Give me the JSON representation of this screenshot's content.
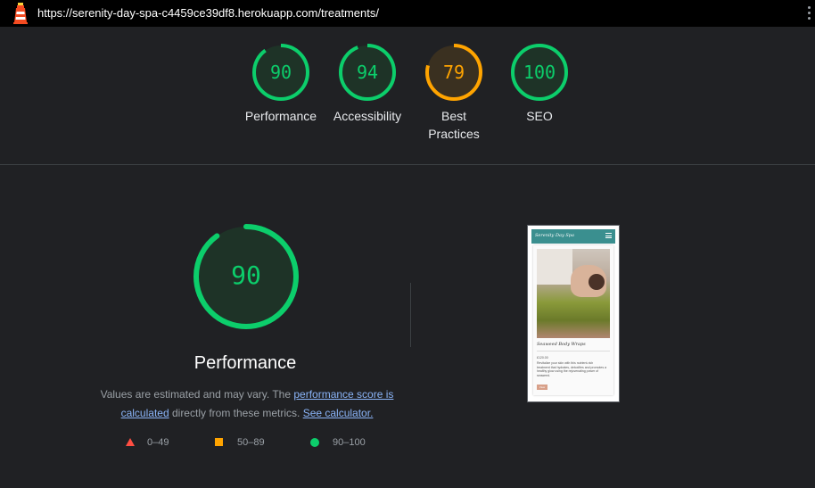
{
  "browser": {
    "url": "https://serenity-day-spa-c4459ce39df8.herokuapp.com/treatments/"
  },
  "categories": [
    {
      "label": "Performance",
      "score": 90,
      "color": "#0cce6b",
      "bg": "#1e3327"
    },
    {
      "label": "Accessibility",
      "score": 94,
      "color": "#0cce6b",
      "bg": "#1e3327"
    },
    {
      "label": "Best Practices",
      "score": 79,
      "color": "#ffa400",
      "bg": "#3a3020"
    },
    {
      "label": "SEO",
      "score": 100,
      "color": "#0cce6b",
      "bg": "#1e3327"
    }
  ],
  "performance": {
    "score": 90,
    "title": "Performance",
    "desc_prefix": "Values are estimated and may vary. The ",
    "score_link": "performance score is calculated",
    "desc_middle": " directly from these metrics. ",
    "calc_link": "See calculator."
  },
  "legend": [
    {
      "range": "0–49",
      "shape": "triangle",
      "color": "#ff4e42"
    },
    {
      "range": "50–89",
      "shape": "square",
      "color": "#ffa400"
    },
    {
      "range": "90–100",
      "shape": "circle",
      "color": "#0cce6b"
    }
  ],
  "screenshot": {
    "brand": "Serenity Day Spa",
    "card_title": "Seaweed Body Wraps",
    "price": "£120.00",
    "text": "Revitalize your skin with this nutrient-rich treatment that hydrates, detoxifies and promotes a healthy glow using the rejuvenating power of seaweed.",
    "button": "View",
    "icons": [
      "lighthouse-icon",
      "kebab-menu-icon",
      "hamburger-menu-icon"
    ]
  }
}
